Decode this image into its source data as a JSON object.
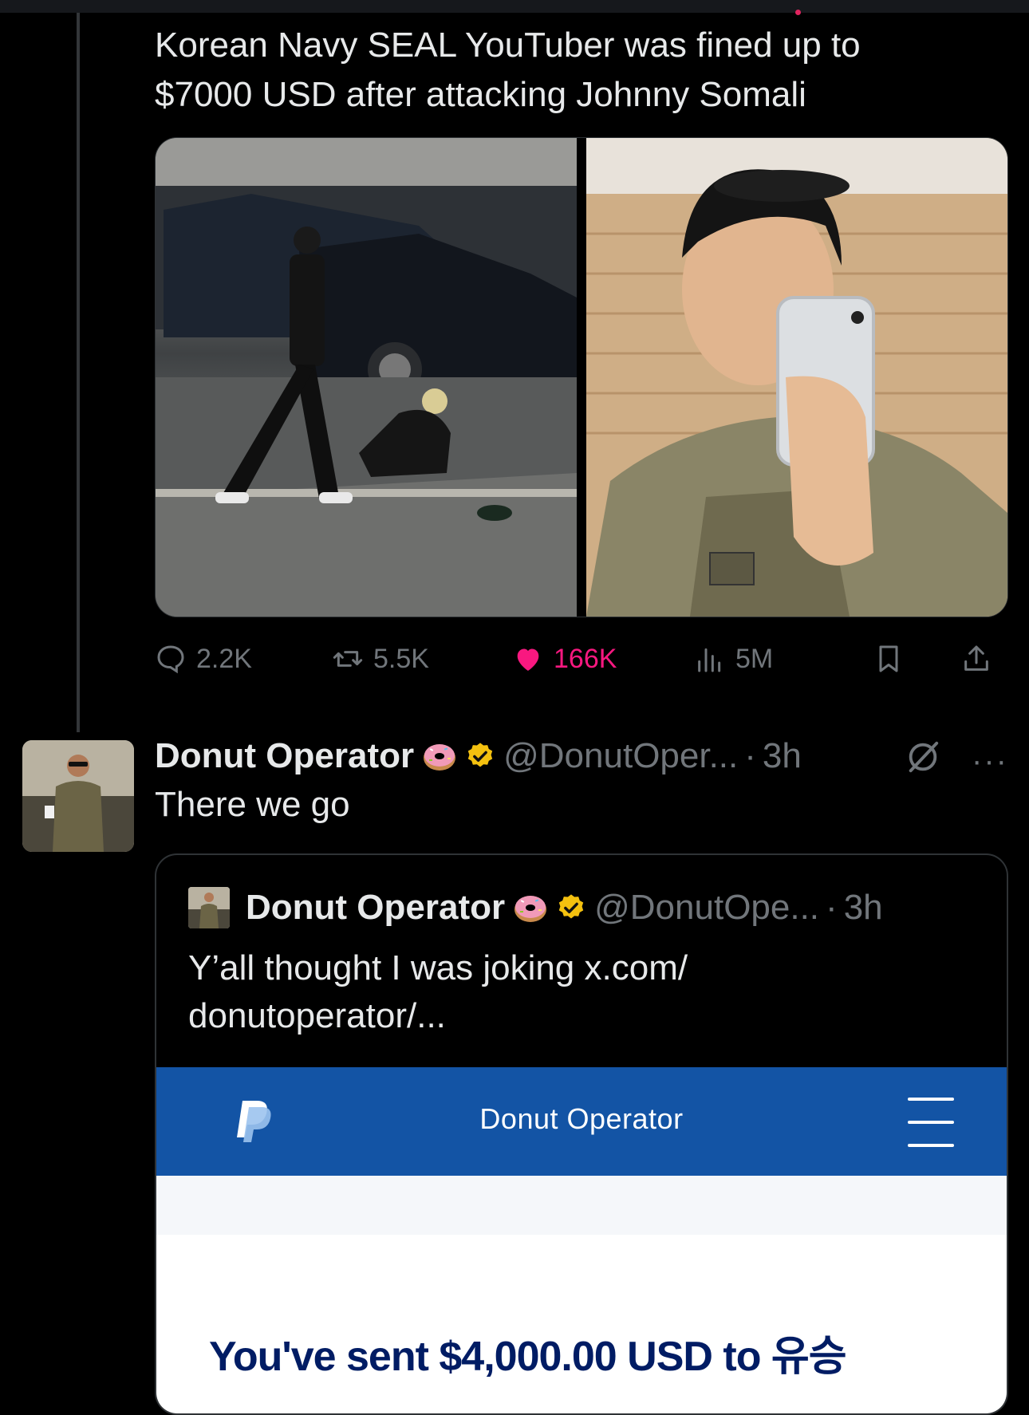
{
  "tweet": {
    "text": "Korean Navy SEAL YouTuber was fined up to $7000 USD after attacking Johnny Somali",
    "stats": {
      "replies": "2.2K",
      "reposts": "5.5K",
      "likes": "166K",
      "views": "5M"
    },
    "media": [
      "photo-street",
      "photo-soldier-selfie"
    ]
  },
  "reply": {
    "display_name": "Donut Operator",
    "handle": "@DonutOper...",
    "separator": "·",
    "time": "3h",
    "text": "There we go",
    "more": "···",
    "icons": {
      "donut": "donut-emoji-icon",
      "verified": "verified-badge-icon",
      "grok": "grok-icon"
    }
  },
  "quote": {
    "display_name": "Donut Operator",
    "handle": "@DonutOpe...",
    "separator": "·",
    "time": "3h",
    "text": "Y’all thought I was joking x.com/ donutoperator/..."
  },
  "paypal": {
    "header_title": "Donut Operator",
    "sent_text": "You've sent $4,000.00 USD to 유승",
    "colors": {
      "bar": "#1354a5",
      "sent_text": "#001c64"
    }
  },
  "colors": {
    "like": "#f91880",
    "muted": "#71767b",
    "verified": "#f4c10f"
  }
}
